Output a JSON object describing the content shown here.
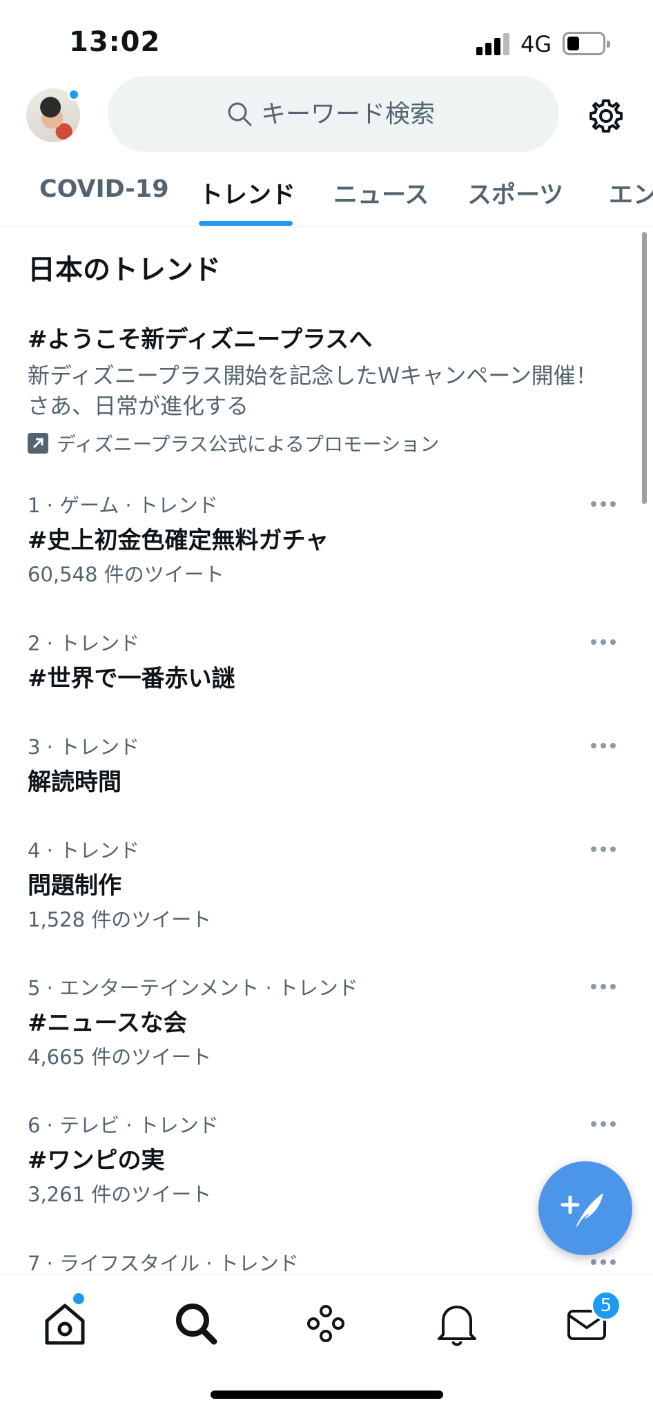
{
  "status_bar": {
    "time": "13:02",
    "network": "4G"
  },
  "search": {
    "placeholder": "キーワード検索"
  },
  "tabs": [
    {
      "label": "COVID-19"
    },
    {
      "label": "トレンド"
    },
    {
      "label": "ニュース"
    },
    {
      "label": "スポーツ"
    },
    {
      "label": "エン"
    }
  ],
  "active_tab": "トレンド",
  "section_title": "日本のトレンド",
  "promo": {
    "title": "#ようこそ新ディズニープラスへ",
    "description": "新ディズニープラス開始を記念したＷキャンペーン開催！さあ、日常が進化する",
    "promoted_by": "ディズニープラス公式によるプロモーション"
  },
  "trends": [
    {
      "meta": "1 · ゲーム · トレンド",
      "name": "#史上初金色確定無料ガチャ",
      "count": "60,548 件のツイート"
    },
    {
      "meta": "2 · トレンド",
      "name": "#世界で一番赤い謎",
      "count": ""
    },
    {
      "meta": "3 · トレンド",
      "name": "解読時間",
      "count": ""
    },
    {
      "meta": "4 · トレンド",
      "name": "問題制作",
      "count": "1,528 件のツイート"
    },
    {
      "meta": "5 · エンターテインメント · トレンド",
      "name": "#ニュースな会",
      "count": "4,665 件のツイート"
    },
    {
      "meta": "6 · テレビ · トレンド",
      "name": "#ワンピの実",
      "count": "3,261 件のツイート"
    },
    {
      "meta": "7 · ライフスタイル · トレンド",
      "name": "",
      "count": ""
    }
  ],
  "nav": {
    "items": [
      "home-icon",
      "search-icon",
      "spaces-icon",
      "notifications-icon",
      "messages-icon"
    ],
    "messages_badge": "5"
  },
  "colors": {
    "accent": "#1d9bf0",
    "fab": "#4c96ea",
    "secondary_text": "#536471"
  }
}
